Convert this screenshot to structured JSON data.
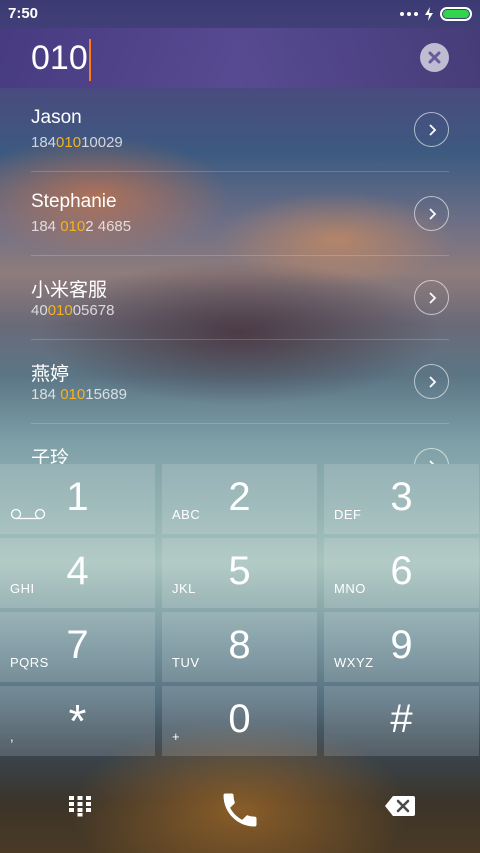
{
  "status": {
    "time": "7:50"
  },
  "dialer": {
    "input": "010"
  },
  "contacts": [
    {
      "name": "Jason",
      "number_pre": "184",
      "number_hl": "010",
      "number_post": "10029"
    },
    {
      "name": "Stephanie",
      "number_pre": "184 ",
      "number_hl": "010",
      "number_post": "2 4685"
    },
    {
      "name": "小米客服",
      "number_pre": "40",
      "number_hl": "010",
      "number_post": "05678"
    },
    {
      "name": "燕婷",
      "number_pre": "184 ",
      "number_hl": "010",
      "number_post": "15689"
    },
    {
      "name": "子玲",
      "number_pre": "",
      "number_hl": "",
      "number_post": ""
    }
  ],
  "keypad": [
    {
      "digit": "1",
      "letters": ""
    },
    {
      "digit": "2",
      "letters": "ABC"
    },
    {
      "digit": "3",
      "letters": "DEF"
    },
    {
      "digit": "4",
      "letters": "GHI"
    },
    {
      "digit": "5",
      "letters": "JKL"
    },
    {
      "digit": "6",
      "letters": "MNO"
    },
    {
      "digit": "7",
      "letters": "PQRS"
    },
    {
      "digit": "8",
      "letters": "TUV"
    },
    {
      "digit": "9",
      "letters": "WXYZ"
    },
    {
      "digit": "*",
      "letters": ","
    },
    {
      "digit": "0",
      "letters": "+"
    },
    {
      "digit": "#",
      "letters": ""
    }
  ],
  "colors": {
    "highlight": "#f5b21a",
    "caret": "#ff7a1a",
    "battery": "#2fd54a",
    "header": "#483a82"
  },
  "icons": {
    "voicemail": "voicemail-icon",
    "clear": "close-icon",
    "chevron": "chevron-right-icon",
    "keypad_toggle": "dialpad-icon",
    "call": "phone-icon",
    "backspace": "backspace-icon"
  }
}
